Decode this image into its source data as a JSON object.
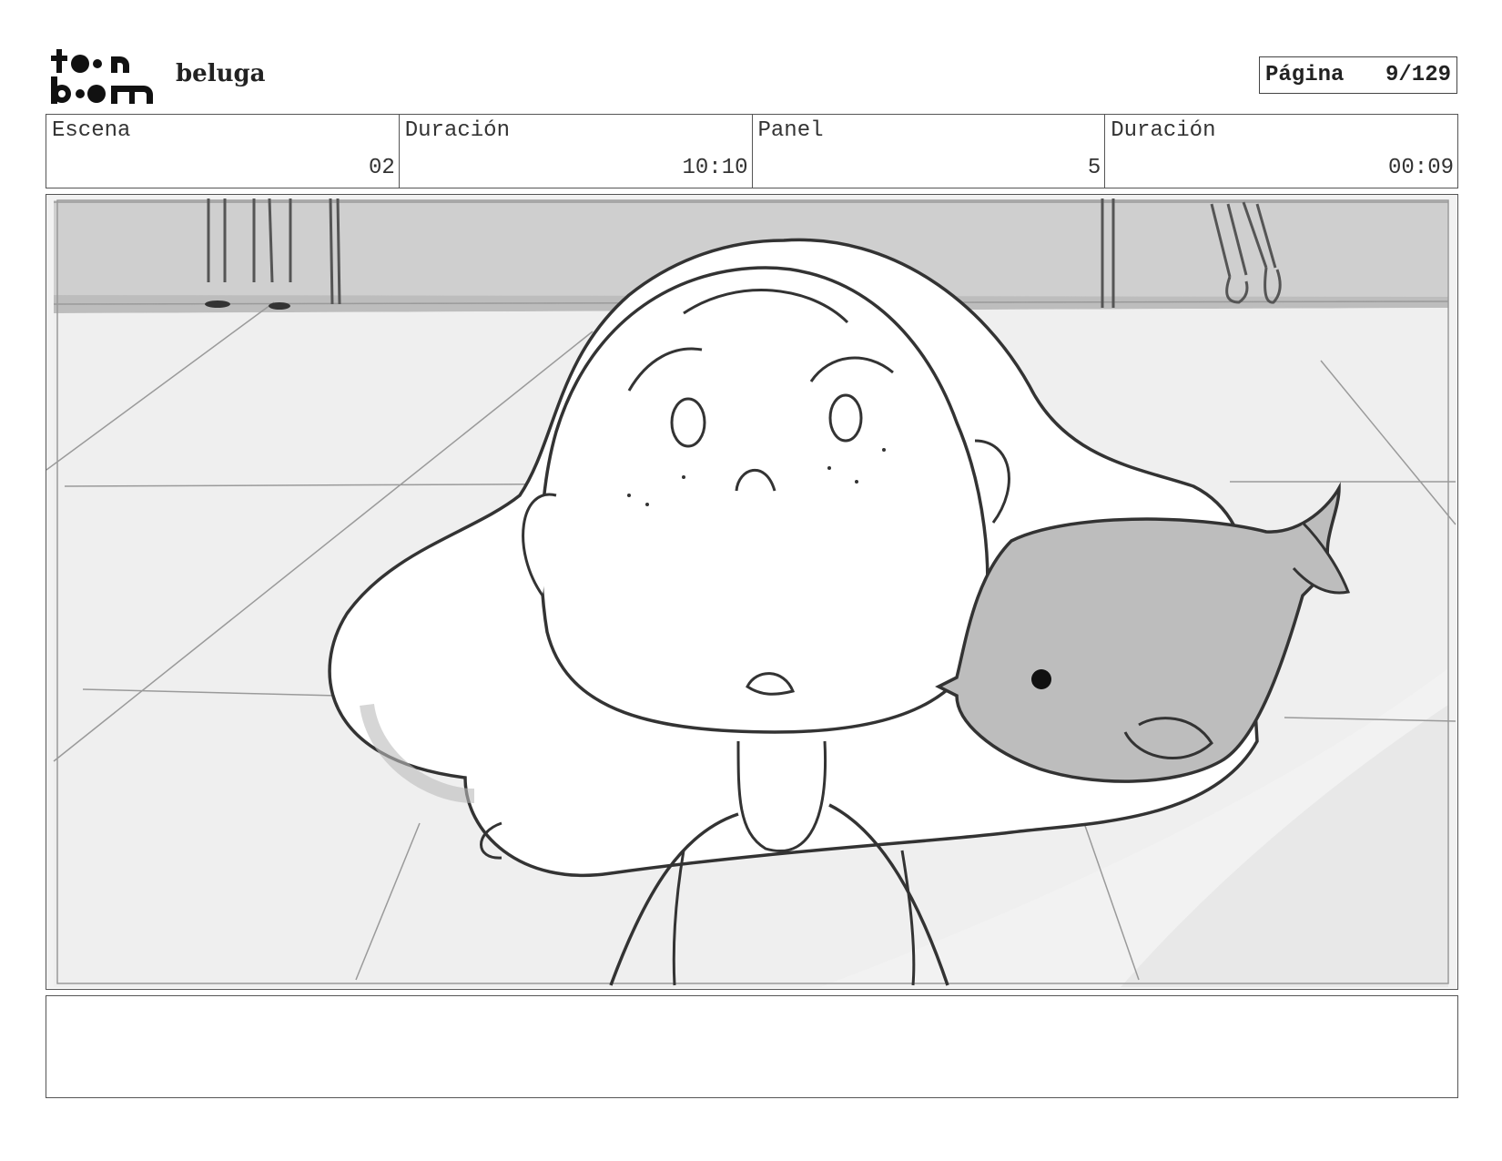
{
  "header": {
    "logo_line1": "t••n",
    "logo_line2": "b••m",
    "project_title": "beluga",
    "page_label": "Página",
    "page_value": "9/129"
  },
  "info": [
    {
      "label": "Escena",
      "value": "02"
    },
    {
      "label": "Duración",
      "value": "10:10"
    },
    {
      "label": "Panel",
      "value": "5"
    },
    {
      "label": "Duración",
      "value": "00:09"
    }
  ],
  "panel": {
    "description": ""
  },
  "notes": {
    "text": ""
  }
}
